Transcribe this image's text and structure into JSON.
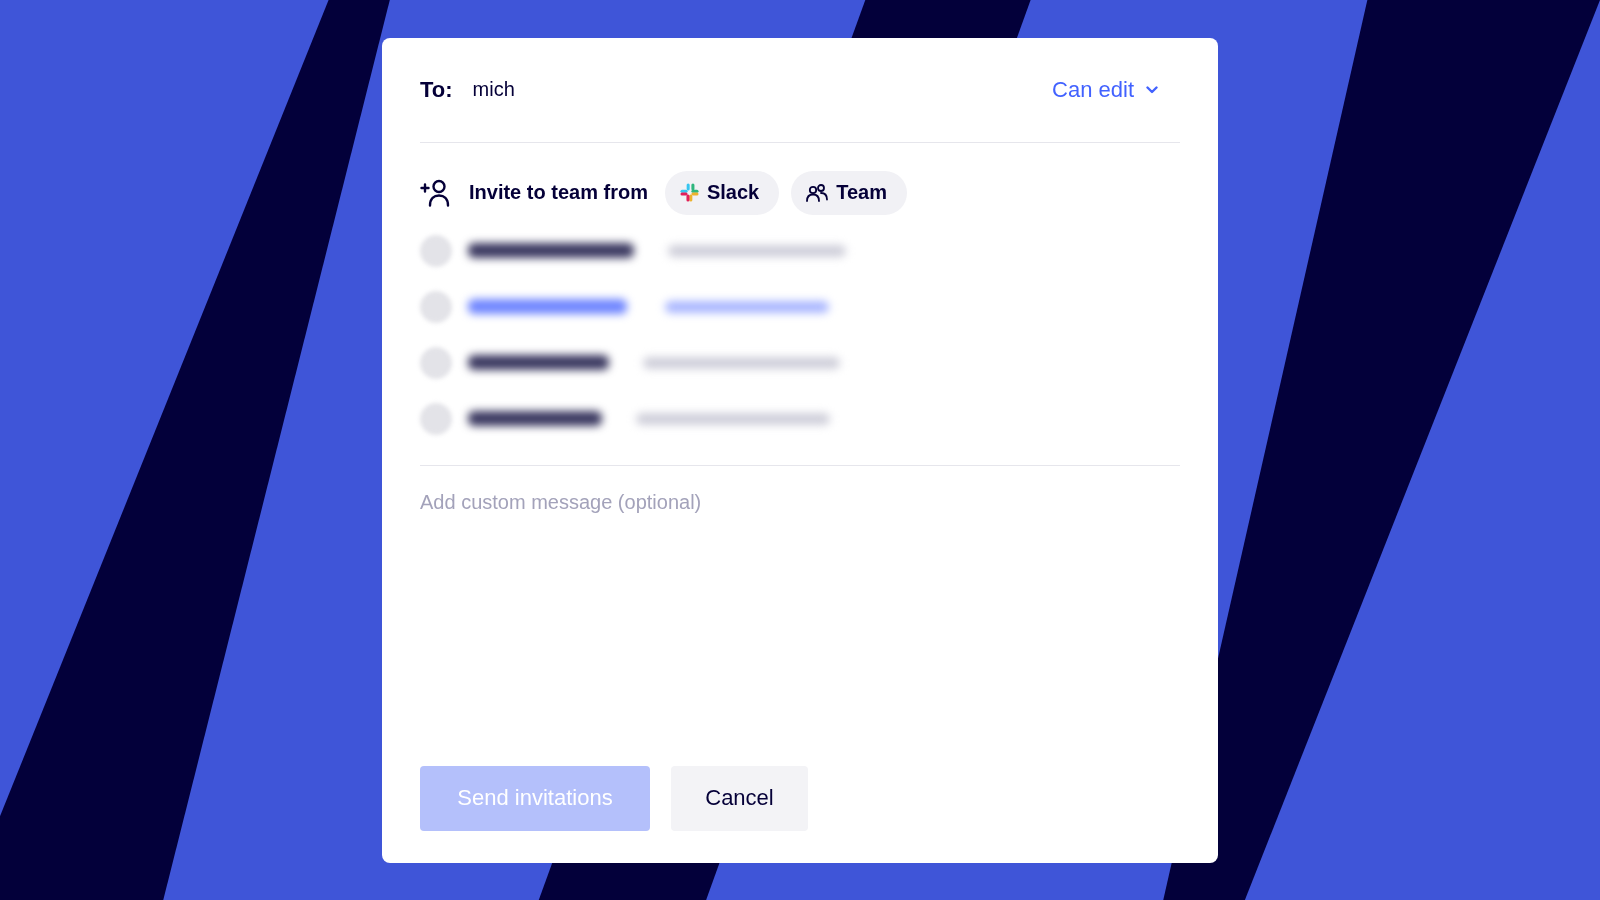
{
  "dialog": {
    "to": {
      "label": "To:",
      "value": "mich"
    },
    "permission": {
      "label": "Can edit"
    },
    "invite": {
      "label": "Invite to team from",
      "sources": [
        {
          "kind": "slack",
          "label": "Slack"
        },
        {
          "kind": "team",
          "label": "Team"
        }
      ]
    },
    "suggestions": [
      {
        "selected": false
      },
      {
        "selected": true
      },
      {
        "selected": false
      },
      {
        "selected": false
      }
    ],
    "message": {
      "placeholder": "Add custom message (optional)"
    },
    "buttons": [
      {
        "kind": "primary",
        "label": "Send invitations",
        "disabled": true
      },
      {
        "kind": "secondary",
        "label": "Cancel",
        "disabled": false
      }
    ]
  }
}
